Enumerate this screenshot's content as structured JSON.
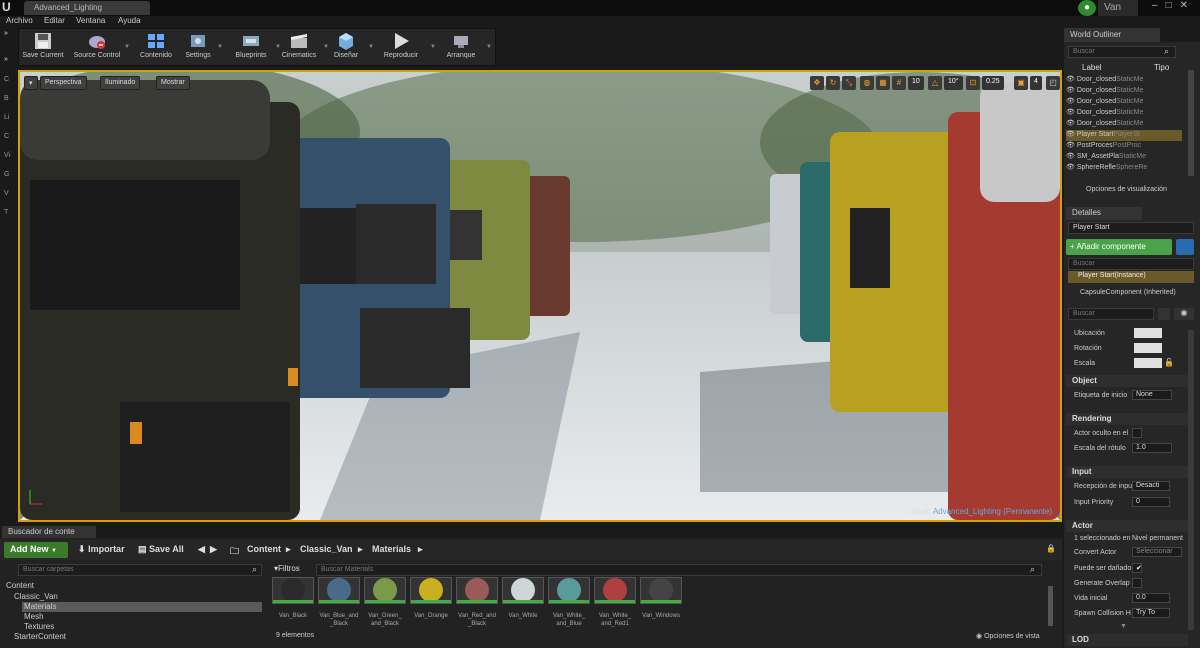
{
  "window": {
    "tab_title": "Advanced_Lighting",
    "user": "Van"
  },
  "menu": [
    "Archivo",
    "Editar",
    "Ventana",
    "Ayuda"
  ],
  "toolbar": [
    {
      "label": "Save Current",
      "icon": "save-icon"
    },
    {
      "label": "Source Control",
      "icon": "source-control-icon"
    },
    {
      "label": "Contenido",
      "icon": "content-icon"
    },
    {
      "label": "Settings",
      "icon": "settings-icon"
    },
    {
      "label": "Blueprints",
      "icon": "blueprints-icon"
    },
    {
      "label": "Cinematics",
      "icon": "cinematics-icon"
    },
    {
      "label": "Diseñar",
      "icon": "build-icon"
    },
    {
      "label": "Reproducir",
      "icon": "play-icon"
    },
    {
      "label": "Arranque",
      "icon": "launch-icon"
    }
  ],
  "left_strip": [
    "C",
    "B",
    "Li",
    "C",
    "Vi",
    "G",
    "V",
    "T"
  ],
  "viewport": {
    "perspective": "Perspectiva",
    "lit": "Iluminado",
    "show": "Mostrar",
    "grid_snap": "10",
    "rot_snap": "10°",
    "scale_snap": "0.25",
    "cam_speed": "4",
    "level_label": "Nivel:",
    "level_name": "Advanced_Lighting (Permanente)"
  },
  "outliner": {
    "tab": "World Outliner",
    "search_placeholder": "Buscar",
    "col_label": "Label",
    "col_type": "Tipo",
    "rows": [
      {
        "label": "Door_closed",
        "type": "StaticMe"
      },
      {
        "label": "Door_closed",
        "type": "StaticMe"
      },
      {
        "label": "Door_closed",
        "type": "StaticMe"
      },
      {
        "label": "Door_closed",
        "type": "StaticMe"
      },
      {
        "label": "Door_closed",
        "type": "StaticMe"
      },
      {
        "label": "Player Start",
        "type": "PlayerSt"
      },
      {
        "label": "PostProces",
        "type": "PostProc"
      },
      {
        "label": "SM_AssetPla",
        "type": "StaticMe"
      },
      {
        "label": "SphereRefle",
        "type": "SphereRe"
      }
    ],
    "view_options": "Opciones de visualización"
  },
  "details": {
    "tab": "Detalles",
    "name": "Player Start",
    "add_component": "+ Añadir componente",
    "search_placeholder": "Buscar",
    "instance": "Player Start(Instance)",
    "component": "CapsuleComponent (Inherited)",
    "transform": {
      "location": "Ubicación",
      "rotation": "Rotación",
      "scale": "Escala"
    },
    "sections": {
      "object": "Object",
      "rendering": "Rendering",
      "input": "Input",
      "actor": "Actor",
      "lod": "LOD"
    },
    "object_props": [
      {
        "label": "Etiqueta de inicio",
        "value": "None"
      }
    ],
    "rendering_props": [
      {
        "label": "Actor oculto en el",
        "value": ""
      },
      {
        "label": "Escala del rótulo",
        "value": "1.0"
      }
    ],
    "input_props": [
      {
        "label": "Recepción de inpu",
        "value": "Desacti"
      },
      {
        "label": "Input Priority",
        "value": "0"
      }
    ],
    "actor_props": [
      {
        "label": "1 seleccionado en",
        "value": "Nivel permanent"
      },
      {
        "label": "Convert Actor",
        "value": "Seleccionar"
      },
      {
        "label": "Puede ser dañado",
        "value": ""
      },
      {
        "label": "Generate Overlap",
        "value": ""
      },
      {
        "label": "Vida inicial",
        "value": "0.0"
      },
      {
        "label": "Spawn Collision H",
        "value": "Try To"
      }
    ]
  },
  "content_browser": {
    "tab": "Buscador de conte",
    "add_new": "Add New",
    "import": "Importar",
    "save_all": "Save All",
    "breadcrumb": [
      "Content",
      "Classic_Van",
      "Materials"
    ],
    "folder_search": "Buscar carpetas",
    "filters": "Filtros",
    "materials_search": "Buscar Materials",
    "tree": [
      "Content",
      "Classic_Van",
      "Materials",
      "Mesh",
      "Textures",
      "StarterContent"
    ],
    "assets": [
      {
        "name": "Van_Black",
        "color": "#2a2a2a"
      },
      {
        "name": "Van_Blue_and\n_Black",
        "color": "#4a6a8a"
      },
      {
        "name": "Van_Green_\nand_Black",
        "color": "#7a9a4a"
      },
      {
        "name": "Van_Orange",
        "color": "#c8b020"
      },
      {
        "name": "Van_Red_and\n_Black",
        "color": "#9a5a5a"
      },
      {
        "name": "Van_White",
        "color": "#cfd6d8"
      },
      {
        "name": "Van_White_\nand_Blue",
        "color": "#5a9a98"
      },
      {
        "name": "Van_White_\nand_Red1",
        "color": "#b04040"
      },
      {
        "name": "Van_Windows",
        "color": "#444444"
      }
    ],
    "count": "9 elementos",
    "view_options": "Opciones de vista"
  }
}
